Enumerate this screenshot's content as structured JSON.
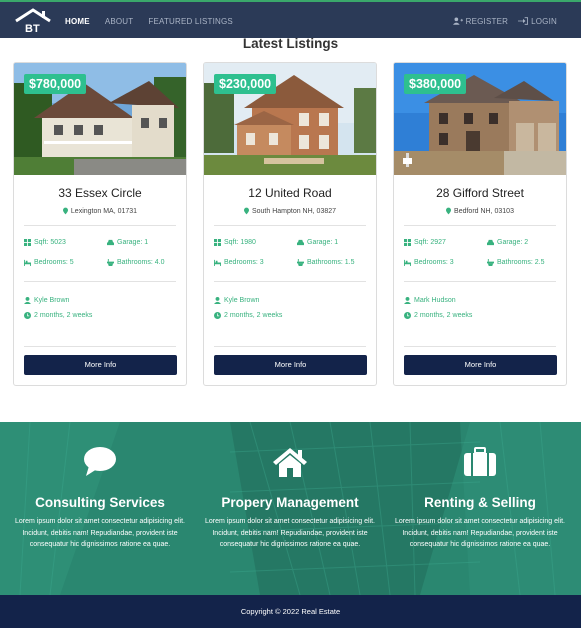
{
  "nav": {
    "brand": "BT",
    "links": [
      "HOME",
      "ABOUT",
      "FEATURED LISTINGS"
    ],
    "register": "REGISTER",
    "login": "LOGIN"
  },
  "listings": {
    "title": "Latest Listings",
    "cards": [
      {
        "price": "$780,000",
        "title": "33 Essex Circle",
        "location": "Lexington MA, 01731",
        "sqft": "Sqft: 5023",
        "garage": "Garage: 1",
        "bedrooms": "Bedrooms: 5",
        "bathrooms": "Bathrooms: 4.0",
        "agent": "Kyle Brown",
        "time": "2 months, 2 weeks",
        "button": "More Info"
      },
      {
        "price": "$230,000",
        "title": "12 United Road",
        "location": "South Hampton NH, 03827",
        "sqft": "Sqft: 1980",
        "garage": "Garage: 1",
        "bedrooms": "Bedrooms: 3",
        "bathrooms": "Bathrooms: 1.5",
        "agent": "Kyle Brown",
        "time": "2 months, 2 weeks",
        "button": "More Info"
      },
      {
        "price": "$380,000",
        "title": "28 Gifford Street",
        "location": "Bedford NH, 03103",
        "sqft": "Sqft: 2927",
        "garage": "Garage: 2",
        "bedrooms": "Bedrooms: 3",
        "bathrooms": "Bathrooms: 2.5",
        "agent": "Mark Hudson",
        "time": "2 months, 2 weeks",
        "button": "More Info"
      }
    ]
  },
  "services": [
    {
      "icon": "chat-bubble-icon",
      "title": "Consulting Services",
      "text": "Lorem ipsum dolor sit amet consectetur adipisicing elit. Incidunt, debitis nam! Repudiandae, provident iste consequatur hic dignissimos ratione ea quae."
    },
    {
      "icon": "home-icon",
      "title": "Propery Management",
      "text": "Lorem ipsum dolor sit amet consectetur adipisicing elit. Incidunt, debitis nam! Repudiandae, provident iste consequatur hic dignissimos ratione ea quae."
    },
    {
      "icon": "suitcase-icon",
      "title": "Renting & Selling",
      "text": "Lorem ipsum dolor sit amet consectetur adipisicing elit. Incidunt, debitis nam! Repudiandae, provident iste consequatur hic dignissimos ratione ea quae."
    }
  ],
  "footer": {
    "copyright": "Copyright © 2022 Real Estate"
  },
  "colors": {
    "navbar": "#2b3a57",
    "accent": "#2ec08f",
    "button": "#13234a",
    "services": "#2a8770"
  }
}
